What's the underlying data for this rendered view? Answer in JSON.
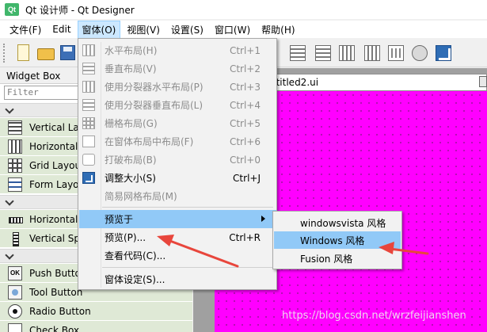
{
  "window": {
    "app_icon_text": "Qt",
    "title": "Qt 设计师 - Qt Designer"
  },
  "menubar": {
    "items": [
      {
        "label": "文件(F)"
      },
      {
        "label": "Edit"
      },
      {
        "label": "窗体(O)"
      },
      {
        "label": "视图(V)"
      },
      {
        "label": "设置(S)"
      },
      {
        "label": "窗口(W)"
      },
      {
        "label": "帮助(H)"
      }
    ]
  },
  "toolbar": {
    "icons": [
      "new-file-icon",
      "open-folder-icon",
      "save-icon",
      "layout-icons"
    ]
  },
  "widget_box": {
    "title": "Widget Box",
    "filter_placeholder": "Filter",
    "layouts": [
      {
        "label": "Vertical La",
        "icon": "vertical-layout-icon"
      },
      {
        "label": "Horizontal",
        "icon": "horizontal-layout-icon"
      },
      {
        "label": "Grid Layou",
        "icon": "grid-layout-icon"
      },
      {
        "label": "Form Layo",
        "icon": "form-layout-icon"
      }
    ],
    "spacers": [
      {
        "label": "Horizontal",
        "icon": "horizontal-spacer-icon"
      },
      {
        "label": "Vertical Sp",
        "icon": "vertical-spacer-icon"
      }
    ],
    "buttons": [
      {
        "label": "Push Butto",
        "icon": "push-button-icon",
        "icon_text": "OK"
      },
      {
        "label": "Tool Button",
        "icon": "tool-button-icon"
      },
      {
        "label": "Radio Button",
        "icon": "radio-button-icon"
      },
      {
        "label": "Check Box",
        "icon": "check-box-icon"
      }
    ]
  },
  "form": {
    "title": "ntitled2.ui",
    "background_color": "#ff00ff"
  },
  "form_menu": {
    "items": [
      {
        "label": "水平布局(H)",
        "shortcut": "Ctrl+1",
        "disabled": true
      },
      {
        "label": "垂直布局(V)",
        "shortcut": "Ctrl+2",
        "disabled": true
      },
      {
        "label": "使用分裂器水平布局(P)",
        "shortcut": "Ctrl+3",
        "disabled": true
      },
      {
        "label": "使用分裂器垂直布局(L)",
        "shortcut": "Ctrl+4",
        "disabled": true
      },
      {
        "label": "栅格布局(G)",
        "shortcut": "Ctrl+5",
        "disabled": true
      },
      {
        "label": "在窗体布局中布局(F)",
        "shortcut": "Ctrl+6",
        "disabled": true
      },
      {
        "label": "打破布局(B)",
        "shortcut": "Ctrl+0",
        "disabled": true
      },
      {
        "label": "调整大小(S)",
        "shortcut": "Ctrl+J",
        "disabled": false
      },
      {
        "label": "简易网格布局(M)",
        "shortcut": "",
        "disabled": true
      },
      {
        "label": "预览于",
        "shortcut": "",
        "disabled": false,
        "highlighted": true
      },
      {
        "label": "预览(P)...",
        "shortcut": "Ctrl+R",
        "disabled": false
      },
      {
        "label": "查看代码(C)...",
        "shortcut": "",
        "disabled": false
      },
      {
        "label": "窗体设定(S)...",
        "shortcut": "",
        "disabled": false
      }
    ]
  },
  "preview_submenu": {
    "items": [
      {
        "label": "windowsvista 风格"
      },
      {
        "label": "Windows 风格",
        "highlighted": true
      },
      {
        "label": "Fusion 风格"
      }
    ]
  },
  "annotation_color": "#e8463c",
  "watermark": "https://blog.csdn.net/wrzfeijianshen"
}
